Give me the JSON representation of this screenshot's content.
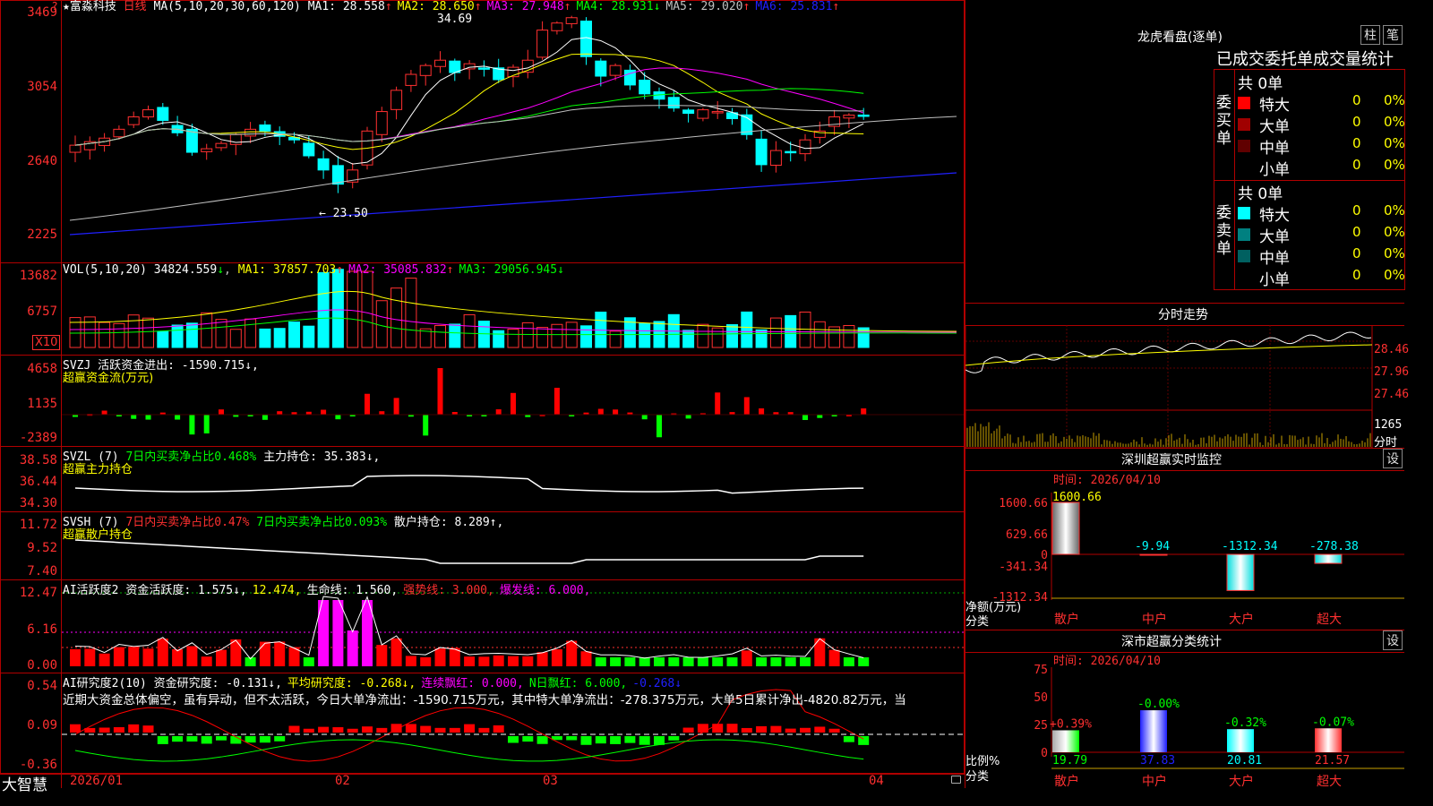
{
  "header": {
    "star": "★",
    "stock_name": "富淼科技",
    "period": "日线",
    "ma_params": "MA(5,10,20,30,60,120)",
    "ma_items": [
      {
        "label": "MA1: 28.558",
        "arrow": "↑",
        "color": "#ffffff"
      },
      {
        "label": "MA2: 28.650",
        "arrow": "↑",
        "color": "#ffff00"
      },
      {
        "label": "MA3: 27.948",
        "arrow": "↑",
        "color": "#ff00ff"
      },
      {
        "label": "MA4: 28.931",
        "arrow": "↓",
        "color": "#00ff00"
      },
      {
        "label": "MA5: 29.020",
        "arrow": "↑",
        "color": "#c0c0c0"
      },
      {
        "label": "MA6: 25.831",
        "arrow": "↑",
        "color": "#2020ff"
      }
    ],
    "top_mark": "?"
  },
  "main_axis": [
    "3469",
    "3054",
    "2640",
    "2225"
  ],
  "price_annotations": {
    "high": "34.69",
    "low": "← 23.50"
  },
  "vol_panel": {
    "title": "VOL(5,10,20)",
    "value": "34824.559",
    "value_arrow": "↓",
    "ma_items": [
      {
        "label": "MA1: 37857.703",
        "arrow": "↑",
        "color": "#ffff00"
      },
      {
        "label": "MA2: 35085.832",
        "arrow": "↑",
        "color": "#ff00ff"
      },
      {
        "label": "MA3: 29056.945",
        "arrow": "↓",
        "color": "#00ff00"
      }
    ],
    "axis": [
      "13682",
      "6757"
    ],
    "unit_badge": "X10"
  },
  "svzj_panel": {
    "title": "SVZJ  活跃资金进出: -1590.715↓,",
    "subtitle": "超赢资金流(万元)",
    "axis": [
      "4658",
      "1135",
      "-2389"
    ]
  },
  "svzl_panel": {
    "title_prefix": "SVZL (7)",
    "title_mid": "7日内买卖净占比0.468%",
    "title_end": "主力持仓: 35.383↓,",
    "subtitle": "超赢主力持仓",
    "axis": [
      "38.58",
      "36.44",
      "34.30"
    ]
  },
  "svsh_panel": {
    "title_prefix": "SVSH (7)",
    "title_mid1": "7日内买卖净占比0.47%",
    "title_mid2": "7日内买卖净占比0.093%",
    "title_end": "散户持仓: 8.289↑,",
    "subtitle": "超赢散户持仓",
    "axis": [
      "11.72",
      "9.52",
      "7.40"
    ]
  },
  "ai_active_panel": {
    "title": "AI活跃度2",
    "items": [
      {
        "label": "资金活跃度: 1.575↓,",
        "color": "#ffffff"
      },
      {
        "label": "12.474,",
        "color": "#ffff00"
      },
      {
        "label": "生命线: 1.560,",
        "color": "#ffffff"
      },
      {
        "label": "强势线: 3.000,",
        "color": "#ff3030"
      },
      {
        "label": "爆发线: 6.000,",
        "color": "#ff00ff"
      }
    ],
    "axis": [
      "12.47",
      "6.16",
      "0.00"
    ]
  },
  "ai_research_panel": {
    "title": "AI研究度2(10)",
    "items": [
      {
        "label": "资金研究度: -0.131↓,",
        "color": "#ffffff"
      },
      {
        "label": "平均研究度: -0.268↓,",
        "color": "#ffff00"
      },
      {
        "label": "连续飘红: 0.000,",
        "color": "#ff00ff"
      },
      {
        "label": "N日飘红: 6.000,",
        "color": "#00ff00"
      },
      {
        "label": "-0.268↓",
        "color": "#2020ff"
      }
    ],
    "commentary": "近期大资金总体偏空，虽有异动，但不太活跃，今日大单净流出：-1590.715万元，其中特大单净流出：-278.375万元，大单5日累计净出-4820.82万元，当",
    "axis": [
      "0.54",
      "0.09",
      "-0.36"
    ]
  },
  "x_axis": {
    "brand": "大智慧",
    "labels": [
      "2026/01",
      "02",
      "03",
      "04"
    ]
  },
  "right_top": {
    "title": "龙虎看盘(逐单)",
    "btn_bar": "柱",
    "btn_pen": "笔",
    "section_title": "已成交委托单成交量统计",
    "buy": {
      "side_label": "委买单",
      "total": "共 0单",
      "rows": [
        {
          "name": "特大",
          "count": "0",
          "pct": "0%",
          "color": "#ff0000"
        },
        {
          "name": "大单",
          "count": "0",
          "pct": "0%",
          "color": "#a00000"
        },
        {
          "name": "中单",
          "count": "0",
          "pct": "0%",
          "color": "#600000"
        },
        {
          "name": "小单",
          "count": "0",
          "pct": "0%",
          "color": "#000000"
        }
      ]
    },
    "sell": {
      "side_label": "委卖单",
      "total": "共 0单",
      "rows": [
        {
          "name": "特大",
          "count": "0",
          "pct": "0%",
          "color": "#00ffff"
        },
        {
          "name": "大单",
          "count": "0",
          "pct": "0%",
          "color": "#008080"
        },
        {
          "name": "中单",
          "count": "0",
          "pct": "0%",
          "color": "#006060"
        },
        {
          "name": "小单",
          "count": "0",
          "pct": "0%",
          "color": "#000000"
        }
      ]
    }
  },
  "intraday": {
    "title": "分时走势",
    "axis": [
      "28.46",
      "27.96",
      "27.46"
    ],
    "vol_axis": "1265",
    "vol_unit": "分时"
  },
  "monitor": {
    "title": "深圳超赢实时监控",
    "btn": "设",
    "time": "时间: 2026/04/10",
    "axis": [
      "1600.66",
      "629.66",
      "0",
      "-341.34",
      "-1312.34"
    ],
    "ylabel": "净额(万元)",
    "xlabel": "分类",
    "categories": [
      "散户",
      "中户",
      "大户",
      "超大"
    ],
    "values": [
      "1600.66",
      "-9.94",
      "-1312.34",
      "-278.38"
    ]
  },
  "classify": {
    "title": "深市超赢分类统计",
    "btn": "设",
    "time": "时间: 2026/04/10",
    "axis": [
      "75",
      "50",
      "25",
      "0"
    ],
    "ylabel": "比例%",
    "xlabel": "分类",
    "categories": [
      "散户",
      "中户",
      "大户",
      "超大"
    ],
    "top_labels": [
      "+0.39%",
      "-0.00%",
      "-0.32%",
      "-0.07%"
    ],
    "bottom_labels": [
      "19.79",
      "37.83",
      "20.81",
      "21.57"
    ]
  },
  "chart_data": {
    "type": "candlestick",
    "series_count": 55,
    "closes": [
      27.3,
      27.5,
      27.7,
      28.2,
      28.9,
      29.3,
      28.7,
      28.0,
      26.9,
      27.1,
      27.4,
      27.9,
      28.2,
      28.1,
      27.8,
      27.6,
      26.7,
      25.9,
      25.1,
      25.9,
      28.1,
      29.2,
      30.4,
      31.3,
      31.8,
      32.1,
      31.4,
      31.9,
      31.6,
      31.0,
      31.7,
      32.1,
      33.8,
      34.2,
      34.5,
      32.3,
      31.2,
      31.8,
      30.7,
      30.2,
      29.9,
      29.4,
      29.1,
      29.3,
      29.2,
      28.8,
      27.9,
      26.2,
      27.0,
      26.9,
      27.6,
      28.1,
      28.9,
      29.0,
      29.0
    ],
    "note": "Price in yuan; main axis tick labels show price×100"
  }
}
